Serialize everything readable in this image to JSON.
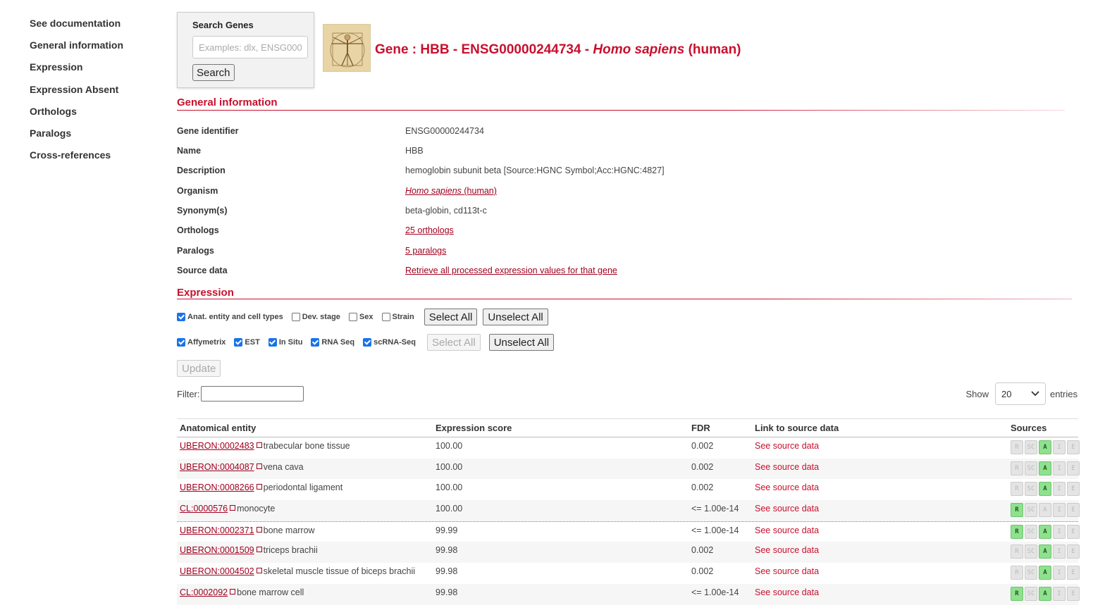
{
  "nav": [
    "See documentation",
    "General information",
    "Expression",
    "Expression Absent",
    "Orthologs",
    "Paralogs",
    "Cross-references"
  ],
  "search": {
    "title": "Search Genes",
    "placeholder": "Examples: dlx, ENSG000",
    "button": "Search"
  },
  "header": {
    "prefix": "Gene : HBB - ENSG00000244734 - ",
    "species": "Homo sapiens",
    "suffix": " (human)"
  },
  "general": {
    "heading": "General information",
    "rows": [
      {
        "label": "Gene identifier",
        "value": "ENSG00000244734"
      },
      {
        "label": "Name",
        "value": "HBB"
      },
      {
        "label": "Description",
        "value": "hemoglobin subunit beta [Source:HGNC Symbol;Acc:HGNC:4827]"
      },
      {
        "label": "Organism",
        "link_species": "Homo sapiens",
        "link_suffix": " (human)"
      },
      {
        "label": "Synonym(s)",
        "value": "beta-globin, cd113t-c"
      },
      {
        "label": "Orthologs",
        "link": "25 orthologs"
      },
      {
        "label": "Paralogs",
        "link": "5 paralogs"
      },
      {
        "label": "Source data",
        "link": "Retrieve all processed expression values for that gene"
      }
    ]
  },
  "expression": {
    "heading": "Expression",
    "conditions": [
      {
        "label": "Anat. entity and cell types",
        "checked": true
      },
      {
        "label": "Dev. stage",
        "checked": false
      },
      {
        "label": "Sex",
        "checked": false
      },
      {
        "label": "Strain",
        "checked": false
      }
    ],
    "datatypes": [
      {
        "label": "Affymetrix",
        "checked": true
      },
      {
        "label": "EST",
        "checked": true
      },
      {
        "label": "In Situ",
        "checked": true
      },
      {
        "label": "RNA Seq",
        "checked": true
      },
      {
        "label": "scRNA-Seq",
        "checked": true
      }
    ],
    "select_all": "Select All",
    "unselect_all": "Unselect All",
    "update": "Update",
    "filter_label": "Filter:",
    "show_label": "Show",
    "show_value": "20",
    "entries_label": "entries",
    "columns": [
      "Anatomical entity",
      "Expression score",
      "FDR",
      "Link to source data",
      "Sources"
    ],
    "source_letters": [
      "R",
      "SC",
      "A",
      "I",
      "E"
    ],
    "rows": [
      {
        "id": "UBERON:0002483",
        "name": "trabecular bone tissue",
        "score": "100.00",
        "fdr": "0.002",
        "link": "See source data",
        "sources": [
          false,
          false,
          true,
          false,
          false
        ]
      },
      {
        "id": "UBERON:0004087",
        "name": "vena cava",
        "score": "100.00",
        "fdr": "0.002",
        "link": "See source data",
        "sources": [
          false,
          false,
          true,
          false,
          false
        ]
      },
      {
        "id": "UBERON:0008266",
        "name": "periodontal ligament",
        "score": "100.00",
        "fdr": "0.002",
        "link": "See source data",
        "sources": [
          false,
          false,
          true,
          false,
          false
        ]
      },
      {
        "id": "CL:0000576",
        "name": "monocyte",
        "score": "100.00",
        "fdr": "<= 1.00e-14",
        "link": "See source data",
        "sources": [
          true,
          false,
          false,
          false,
          false
        ]
      },
      {
        "id": "UBERON:0002371",
        "name": "bone marrow",
        "score": "99.99",
        "fdr": "<= 1.00e-14",
        "link": "See source data",
        "sources": [
          true,
          false,
          true,
          false,
          false
        ]
      },
      {
        "id": "UBERON:0001509",
        "name": "triceps brachii",
        "score": "99.98",
        "fdr": "0.002",
        "link": "See source data",
        "sources": [
          false,
          false,
          true,
          false,
          false
        ]
      },
      {
        "id": "UBERON:0004502",
        "name": "skeletal muscle tissue of biceps brachii",
        "score": "99.98",
        "fdr": "0.002",
        "link": "See source data",
        "sources": [
          false,
          false,
          true,
          false,
          false
        ]
      },
      {
        "id": "CL:0002092",
        "name": "bone marrow cell",
        "score": "99.98",
        "fdr": "<= 1.00e-14",
        "link": "See source data",
        "sources": [
          true,
          false,
          true,
          false,
          false
        ]
      }
    ]
  }
}
